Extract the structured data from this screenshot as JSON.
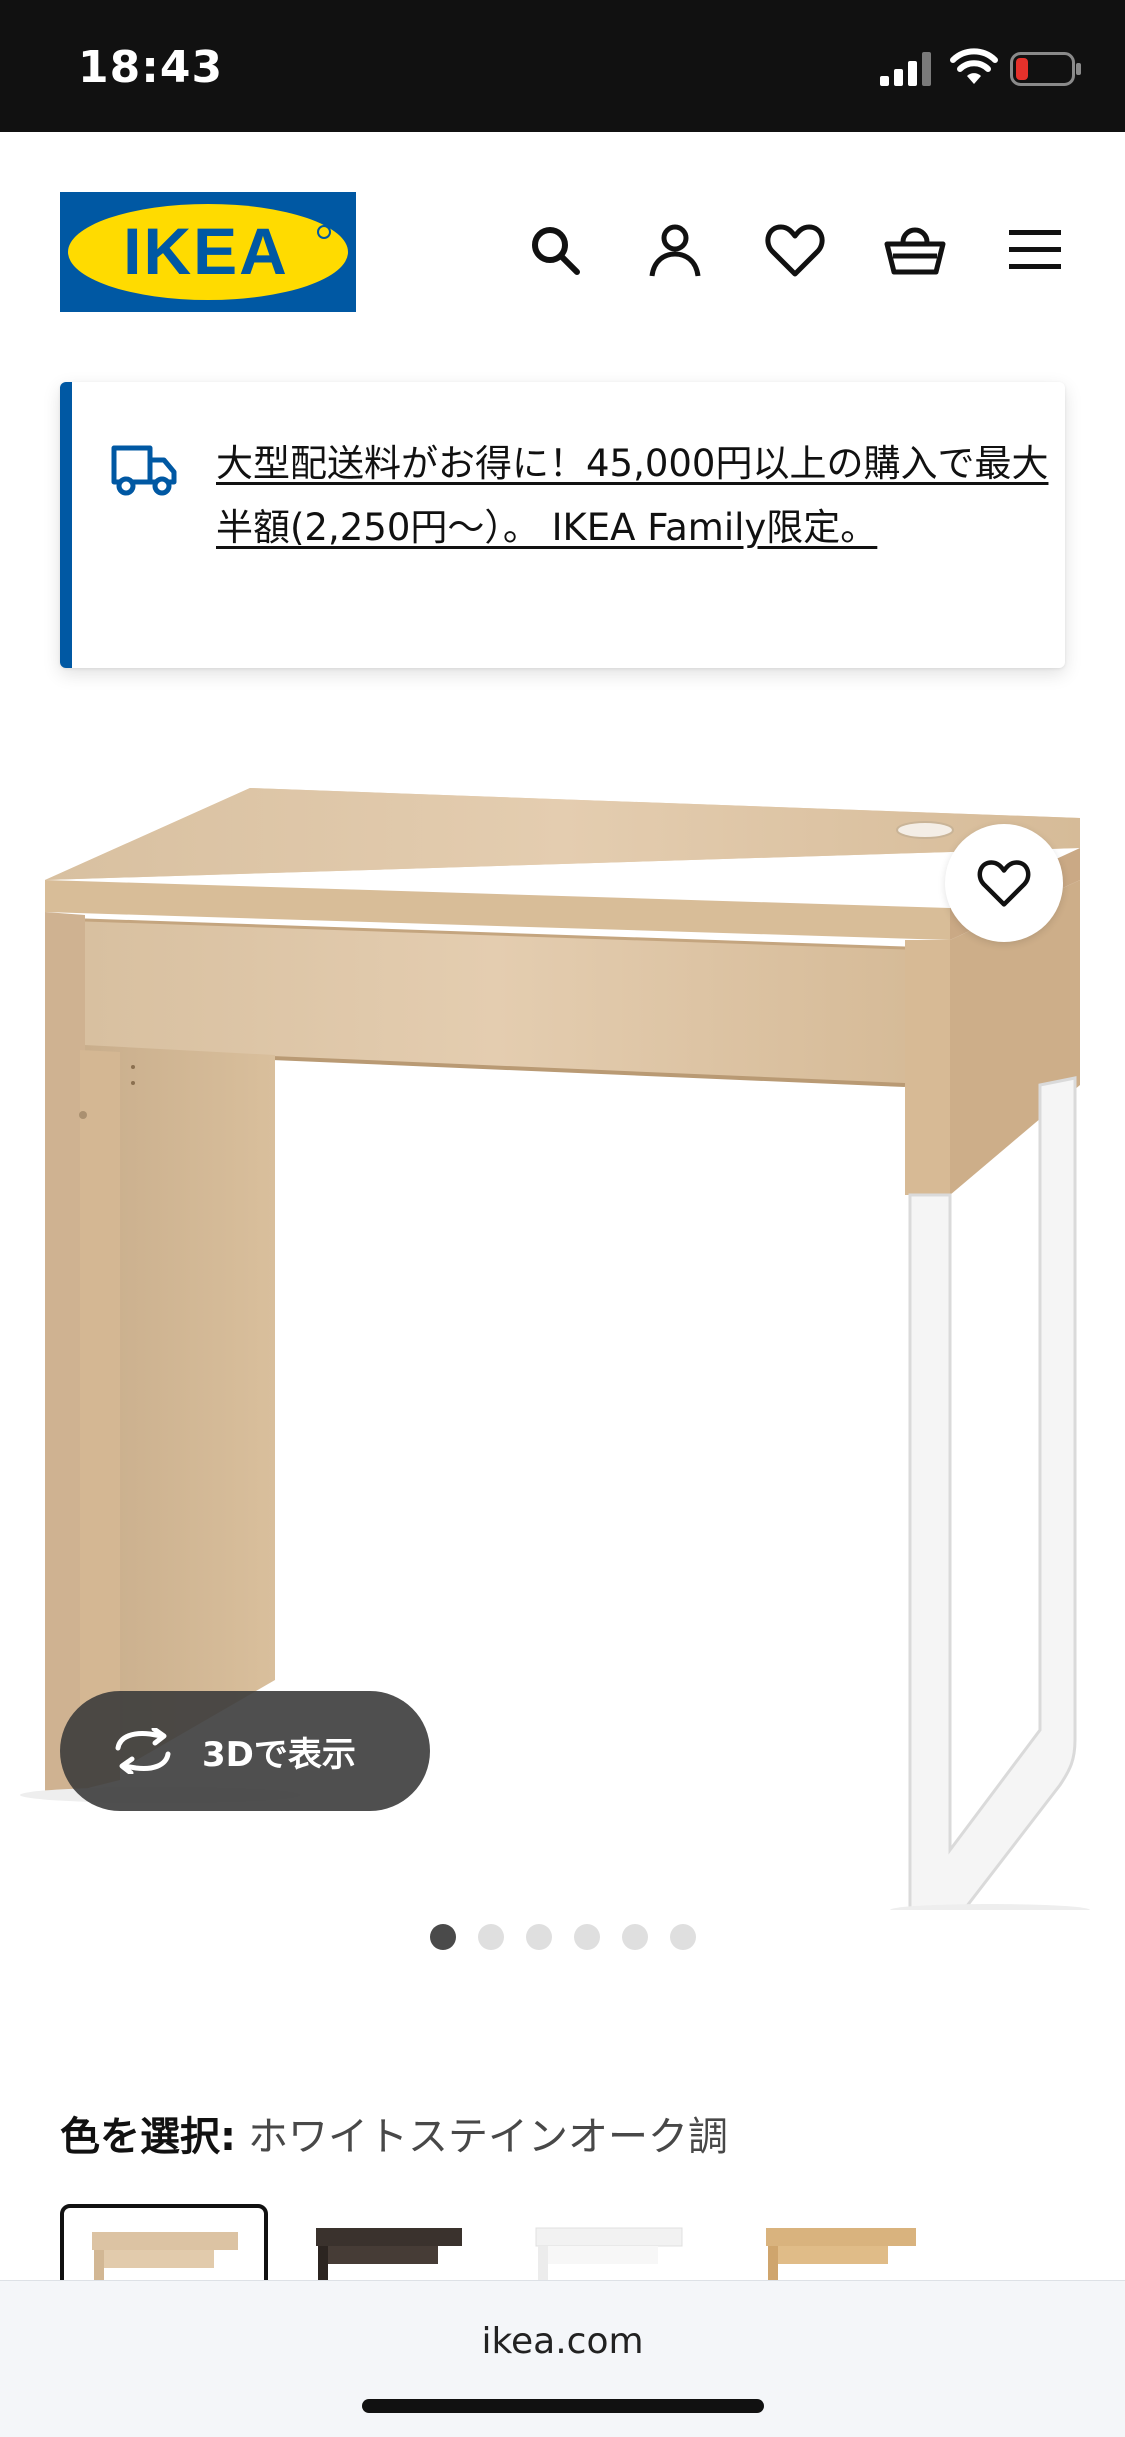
{
  "status_bar": {
    "time": "18:43"
  },
  "header": {
    "logo_text": "IKEA",
    "icons": [
      "search-icon",
      "account-icon",
      "heart-icon",
      "basket-icon",
      "menu-icon"
    ]
  },
  "promo": {
    "text": "大型配送料がお得に！45,000円以上の購入で最大半額(2,250円〜）。 IKEA Family限定。",
    "icon": "truck-icon"
  },
  "product": {
    "view_3d_label": "3Dで表示",
    "image_count": 6,
    "active_image": 1
  },
  "color_select": {
    "label": "色を選択:",
    "value": "ホワイトステインオーク調"
  },
  "browser": {
    "url": "ikea.com"
  },
  "colors": {
    "ikea_blue": "#0058a3",
    "ikea_yellow": "#ffdb00",
    "status_bar_bg": "#111111",
    "battery_low": "#e5312b"
  }
}
